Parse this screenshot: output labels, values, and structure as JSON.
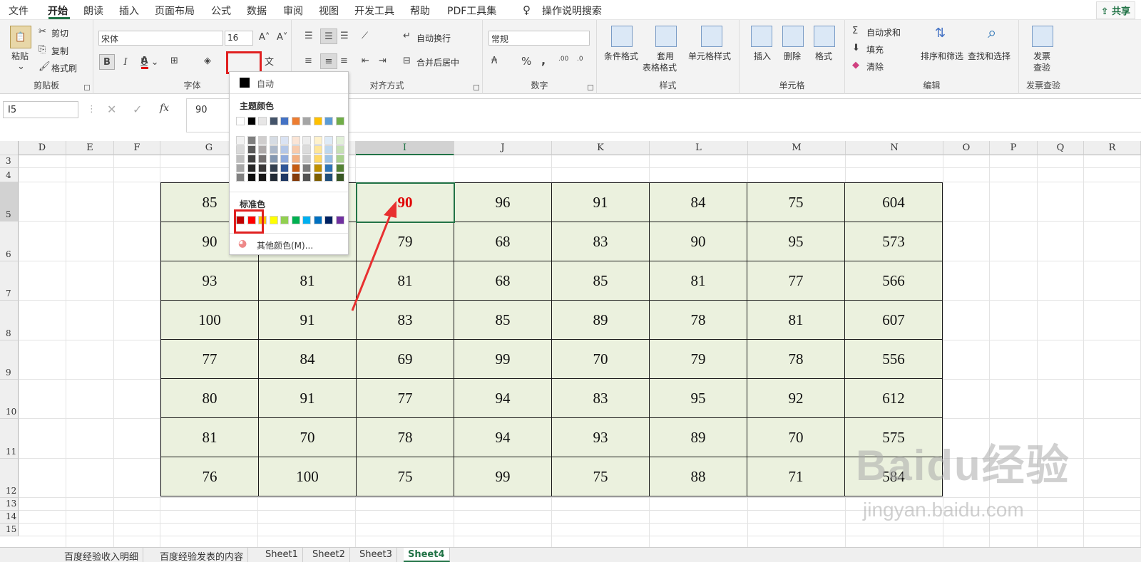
{
  "menu": {
    "tabs": [
      "文件",
      "开始",
      "朗读",
      "插入",
      "页面布局",
      "公式",
      "数据",
      "审阅",
      "视图",
      "开发工具",
      "帮助",
      "PDF工具集"
    ],
    "search": "操作说明搜索",
    "share": "共享"
  },
  "ribbon": {
    "clipboard": {
      "paste": "粘贴",
      "cut": "剪切",
      "copy": "复制",
      "painter": "格式刷",
      "label": "剪贴板"
    },
    "font": {
      "name": "宋体",
      "size": "16",
      "bold": "B",
      "italic": "I",
      "underline": "U",
      "label": "字体"
    },
    "align": {
      "wrap": "自动换行",
      "merge": "合并后居中",
      "label": "对齐方式"
    },
    "number": {
      "format": "常规",
      "percent": "%",
      "comma": ",",
      "label": "数字"
    },
    "styles": {
      "cond": "条件格式",
      "table_line1": "套用",
      "table_line2": "表格格式",
      "cell": "单元格样式",
      "label": "样式"
    },
    "cells": {
      "insert": "插入",
      "delete": "删除",
      "format": "格式",
      "label": "单元格"
    },
    "edit": {
      "autosum": "自动求和",
      "fill": "填充",
      "clear": "清除",
      "sort": "排序和筛选",
      "find": "查找和选择",
      "label": "编辑"
    },
    "invoice": {
      "line1": "发票",
      "line2": "查验",
      "label": "发票查验"
    }
  },
  "formula": {
    "cell_ref": "I5",
    "value": "90",
    "fx": "fx"
  },
  "columns": [
    "D",
    "E",
    "F",
    "G",
    "H",
    "I",
    "J",
    "K",
    "L",
    "M",
    "N",
    "O",
    "P",
    "Q",
    "R"
  ],
  "rows": [
    "3",
    "4",
    "5",
    "6",
    "7",
    "8",
    "9",
    "10",
    "11",
    "12",
    "13",
    "14",
    "15"
  ],
  "table": [
    [
      "85",
      "",
      "90",
      "96",
      "91",
      "84",
      "75",
      "604"
    ],
    [
      "90",
      "",
      "79",
      "68",
      "83",
      "90",
      "95",
      "573"
    ],
    [
      "93",
      "81",
      "81",
      "68",
      "85",
      "81",
      "77",
      "566"
    ],
    [
      "100",
      "91",
      "83",
      "85",
      "89",
      "78",
      "81",
      "607"
    ],
    [
      "77",
      "84",
      "69",
      "99",
      "70",
      "79",
      "78",
      "556"
    ],
    [
      "80",
      "91",
      "77",
      "94",
      "83",
      "95",
      "92",
      "612"
    ],
    [
      "81",
      "70",
      "78",
      "94",
      "93",
      "89",
      "70",
      "575"
    ],
    [
      "76",
      "100",
      "75",
      "99",
      "75",
      "88",
      "71",
      "584"
    ]
  ],
  "dropdown": {
    "auto": "自动",
    "theme_title": "主题颜色",
    "standard_title": "标准色",
    "more": "其他颜色(M)...",
    "theme_top": [
      "#ffffff",
      "#000000",
      "#e7e6e6",
      "#44546a",
      "#4472c4",
      "#ed7d31",
      "#a5a5a5",
      "#ffc000",
      "#5b9bd5",
      "#70ad47"
    ],
    "theme_cols": [
      [
        "#f2f2f2",
        "#d9d9d9",
        "#bfbfbf",
        "#a6a6a6",
        "#808080"
      ],
      [
        "#7f7f7f",
        "#595959",
        "#3f3f3f",
        "#262626",
        "#0d0d0d"
      ],
      [
        "#d0cece",
        "#aeaaaa",
        "#757171",
        "#3a3838",
        "#171616"
      ],
      [
        "#d6dce4",
        "#adb9ca",
        "#8497b0",
        "#333f4f",
        "#222a35"
      ],
      [
        "#dae3f3",
        "#b4c7e7",
        "#8faadc",
        "#2f5597",
        "#1f3864"
      ],
      [
        "#fbe5d6",
        "#f8cbad",
        "#f4b183",
        "#c55a11",
        "#843c0c"
      ],
      [
        "#ededed",
        "#dbdbdb",
        "#c9c9c9",
        "#7b7b7b",
        "#525252"
      ],
      [
        "#fff2cc",
        "#ffe699",
        "#ffd966",
        "#bf9000",
        "#7f6000"
      ],
      [
        "#deebf7",
        "#bdd7ee",
        "#9dc3e6",
        "#2e75b6",
        "#1f4e79"
      ],
      [
        "#e2f0d9",
        "#c5e0b4",
        "#a9d18e",
        "#548235",
        "#375623"
      ]
    ],
    "standard": [
      "#c00000",
      "#ff0000",
      "#ffc000",
      "#ffff00",
      "#92d050",
      "#00b050",
      "#00b0f0",
      "#0070c0",
      "#002060",
      "#7030a0"
    ]
  },
  "sheets": [
    "百度经验收入明细",
    "百度经验发表的内容",
    "Sheet1",
    "Sheet2",
    "Sheet3",
    "Sheet4"
  ],
  "watermark": {
    "brand": "Baidu经验",
    "url": "jingyan.baidu.com"
  },
  "colors": {
    "accent": "#217346",
    "cell_fill": "#ebf1de",
    "highlight": "#e02020"
  }
}
